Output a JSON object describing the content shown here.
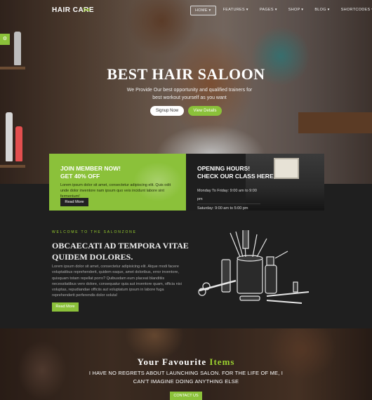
{
  "nav": {
    "logo": "HAIR CARE",
    "menu": [
      "HOME",
      "FEATURES",
      "PAGES",
      "SHOP",
      "BLOG",
      "SHORTCODES"
    ],
    "active_index": 0
  },
  "hero": {
    "title": "BEST HAIR SALOON",
    "subtitle": "We Provide Our best opportunity and qualified trainers for best workout yourself as you want",
    "signup_label": "Signup Now",
    "details_label": "View Details"
  },
  "promo_member": {
    "title_line1": "JOIN MEMBER NOW!",
    "title_line2": "GET 40% OFF",
    "text": "Lorem ipsum dolor sit amet, consectetur adipiscing elit. Quis odit unde dolor inventore nam ipsum quo veis incidunt labore sint fermentum!",
    "button": "Read More"
  },
  "promo_hours": {
    "title_line1": "OPENING HOURS!",
    "title_line2": "CHECK OUR CLASS HERE",
    "row1": "Monday To Friday: 9:00 am to 9:00 pm",
    "row2": "Saturday: 9:00 am to 5:00 pm"
  },
  "about": {
    "eyebrow": "WELCOME TO THE SALONZONE",
    "title": "OBCAECATI AD TEMPORA VITAE QUIDEM DOLORES.",
    "text": "Lorem ipsum dolor sit amet, consectetur adipisicing elit. Atque modi facere voluptatibus reprehenderit, quidem eaque, amet doloribus, error inventore, quisquam totam repellat porro? Quibusdam eum placeat blanditiis necessitatibus vero dolore, consequatur quia aut inventore quam, officia nisi voluptas, repudiandae officiis aut voluptatum ipsum in labore fuga reprehenderit perferendis dolor soluta!",
    "button": "Read More"
  },
  "favourite": {
    "title_main": "Your Favourite ",
    "title_highlight": "Items",
    "quote": "I HAVE NO REGRETS ABOUT LAUNCHING SALON. FOR THE LIFE OF ME, I CAN'T IMAGINE DOING ANYTHING ELSE",
    "button": "CONTACT US"
  },
  "colors": {
    "accent": "#8bc13a",
    "dark": "#1f1f1f"
  }
}
